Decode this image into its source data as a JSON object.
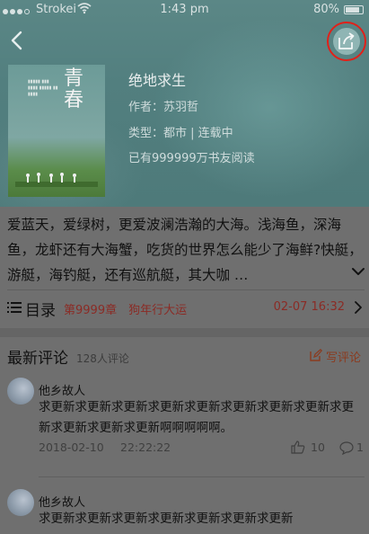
{
  "status_bar": {
    "carrier": "Strokei",
    "time": "1:43 pm",
    "battery": "80%"
  },
  "book": {
    "title": "绝地求生",
    "author": "作者：苏羽哲",
    "type": "类型：都市 | 连载中",
    "readers": "已有999999万书友阅读",
    "cover_title": "青春",
    "description": "爱蓝天，爱绿树，更爱波澜浩瀚的大海。浅海鱼，深海鱼，龙虾还有大海蟹，吃货的世界怎么能少了海鲜?快艇，游艇，海钓艇，还有巡航艇，其大咖 …"
  },
  "toc": {
    "label": "目录",
    "latest_chapter": "第9999章　狗年行大运",
    "updated": "02-07 16:32"
  },
  "comments": {
    "title": "最新评论",
    "count": "128人评论",
    "write_label": "写评论",
    "items": [
      {
        "name": "他乡故人",
        "text": "求更新求更新求更新求更新求更新求更新求更新求更新求更新求更新求更新求更新啊啊啊啊啊。",
        "date": "2018-02-10",
        "time": "22:22:22",
        "likes": "10",
        "replies": "1"
      },
      {
        "name": "他乡故人",
        "text": "求更新求更新求更新求更新求更新求更新求更新"
      }
    ]
  },
  "colors": {
    "accent_red": "#e0211a",
    "header_teal": "#527f7f"
  }
}
